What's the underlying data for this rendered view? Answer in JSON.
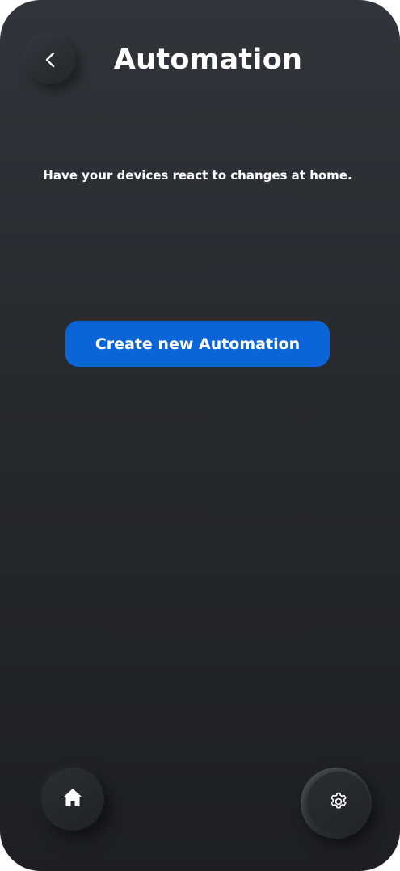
{
  "header": {
    "title": "Automation",
    "back_icon": "chevron-left-icon"
  },
  "main": {
    "subtitle": "Have your devices react to changes at home.",
    "create_button_label": "Create new Automation"
  },
  "bottom_nav": {
    "home_icon": "home-icon",
    "settings_icon": "gear-icon"
  },
  "colors": {
    "background_top": "#31343a",
    "background_bottom": "#1d1f23",
    "accent": "#0a66d8",
    "text": "#ffffff"
  }
}
